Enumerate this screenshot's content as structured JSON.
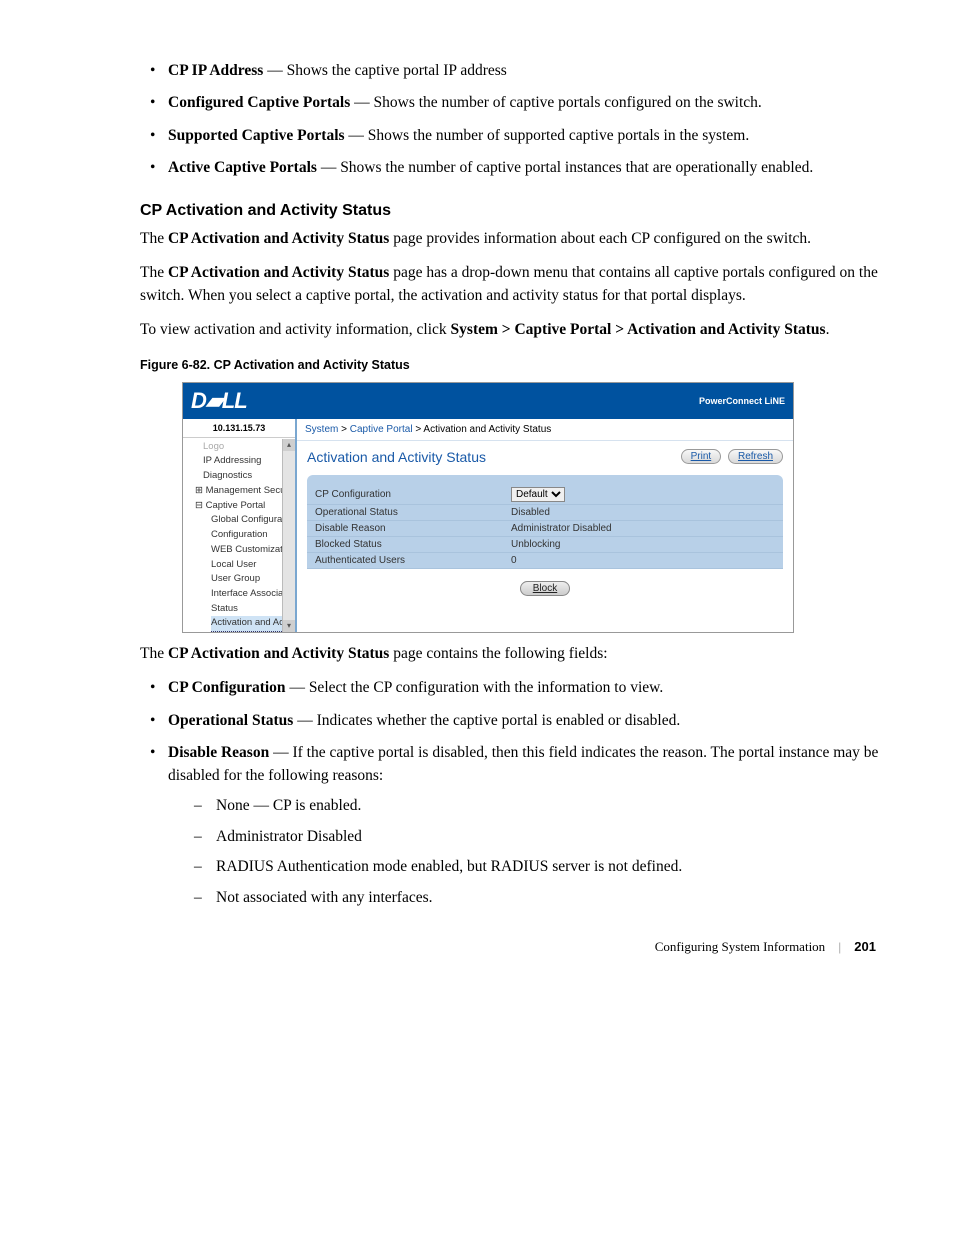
{
  "top_bullets": [
    {
      "term": "CP IP Address",
      "desc": " — Shows the captive portal IP address"
    },
    {
      "term": "Configured Captive Portals",
      "desc": " — Shows the number of captive portals configured on the switch."
    },
    {
      "term": "Supported Captive Portals",
      "desc": " — Shows the number of supported captive portals in the system."
    },
    {
      "term": "Active Captive Portals",
      "desc": " — Shows the number of captive portal instances that are operationally enabled."
    }
  ],
  "section_heading": "CP Activation and Activity Status",
  "para1_a": "The ",
  "para1_b": "CP Activation and Activity Status",
  "para1_c": " page provides information about each CP configured on the switch.",
  "para2_a": "The ",
  "para2_b": "CP Activation and Activity Status",
  "para2_c": " page has a drop-down menu that contains all captive portals configured on the switch. When you select a captive portal, the activation and activity status for that portal displays.",
  "para3_a": "To view activation and activity information, click ",
  "para3_b": "System > Captive Portal > Activation and Activity Status",
  "para3_c": ".",
  "figure_caption": "Figure 6-82.    CP Activation and Activity Status",
  "shot": {
    "logo": "D▰LL",
    "brand": "PowerConnect LiNE",
    "ip": "10.131.15.73",
    "tree": {
      "i0": "Logo",
      "i1": "IP Addressing",
      "i2": "Diagnostics",
      "i3": "Management Securit",
      "i4": "Captive Portal",
      "i5": "Global Configurati",
      "i6": "Configuration",
      "i7": "WEB Customizat",
      "i8": "Local User",
      "i9": "User Group",
      "i10": "Interface Associat",
      "i11": "Status",
      "i12": "Activation and Ac"
    },
    "crumb_sys": "System",
    "crumb_cp": "Captive Portal",
    "crumb_leaf": " > Activation and Activity Status",
    "crumb_sep": " > ",
    "title": "Activation and Activity Status",
    "print": "Print",
    "refresh": "Refresh",
    "rows": {
      "r1k": "CP Configuration",
      "r1v": "Default",
      "r2k": "Operational Status",
      "r2v": "Disabled",
      "r3k": "Disable Reason",
      "r3v": "Administrator Disabled",
      "r4k": "Blocked Status",
      "r4v": "Unblocking",
      "r5k": "Authenticated Users",
      "r5v": "0"
    },
    "block": "Block"
  },
  "after_shot_a": "The ",
  "after_shot_b": "CP Activation and Activity Status",
  "after_shot_c": " page contains the following fields:",
  "fields": {
    "f1_term": "CP Configuration",
    "f1_desc": " — Select the CP configuration with the information to view.",
    "f2_term": "Operational Status",
    "f2_desc": " — Indicates whether the captive portal is enabled or disabled.",
    "f3_term": "Disable Reason",
    "f3_desc": " — If the captive portal is disabled, then this field indicates the reason. The portal instance may be disabled for the following reasons:",
    "sub1": "None — CP is enabled.",
    "sub2": "Administrator Disabled",
    "sub3": "RADIUS Authentication mode enabled, but RADIUS server is not defined.",
    "sub4": "Not associated with any interfaces."
  },
  "footer_text": "Configuring System Information",
  "page_num": "201"
}
